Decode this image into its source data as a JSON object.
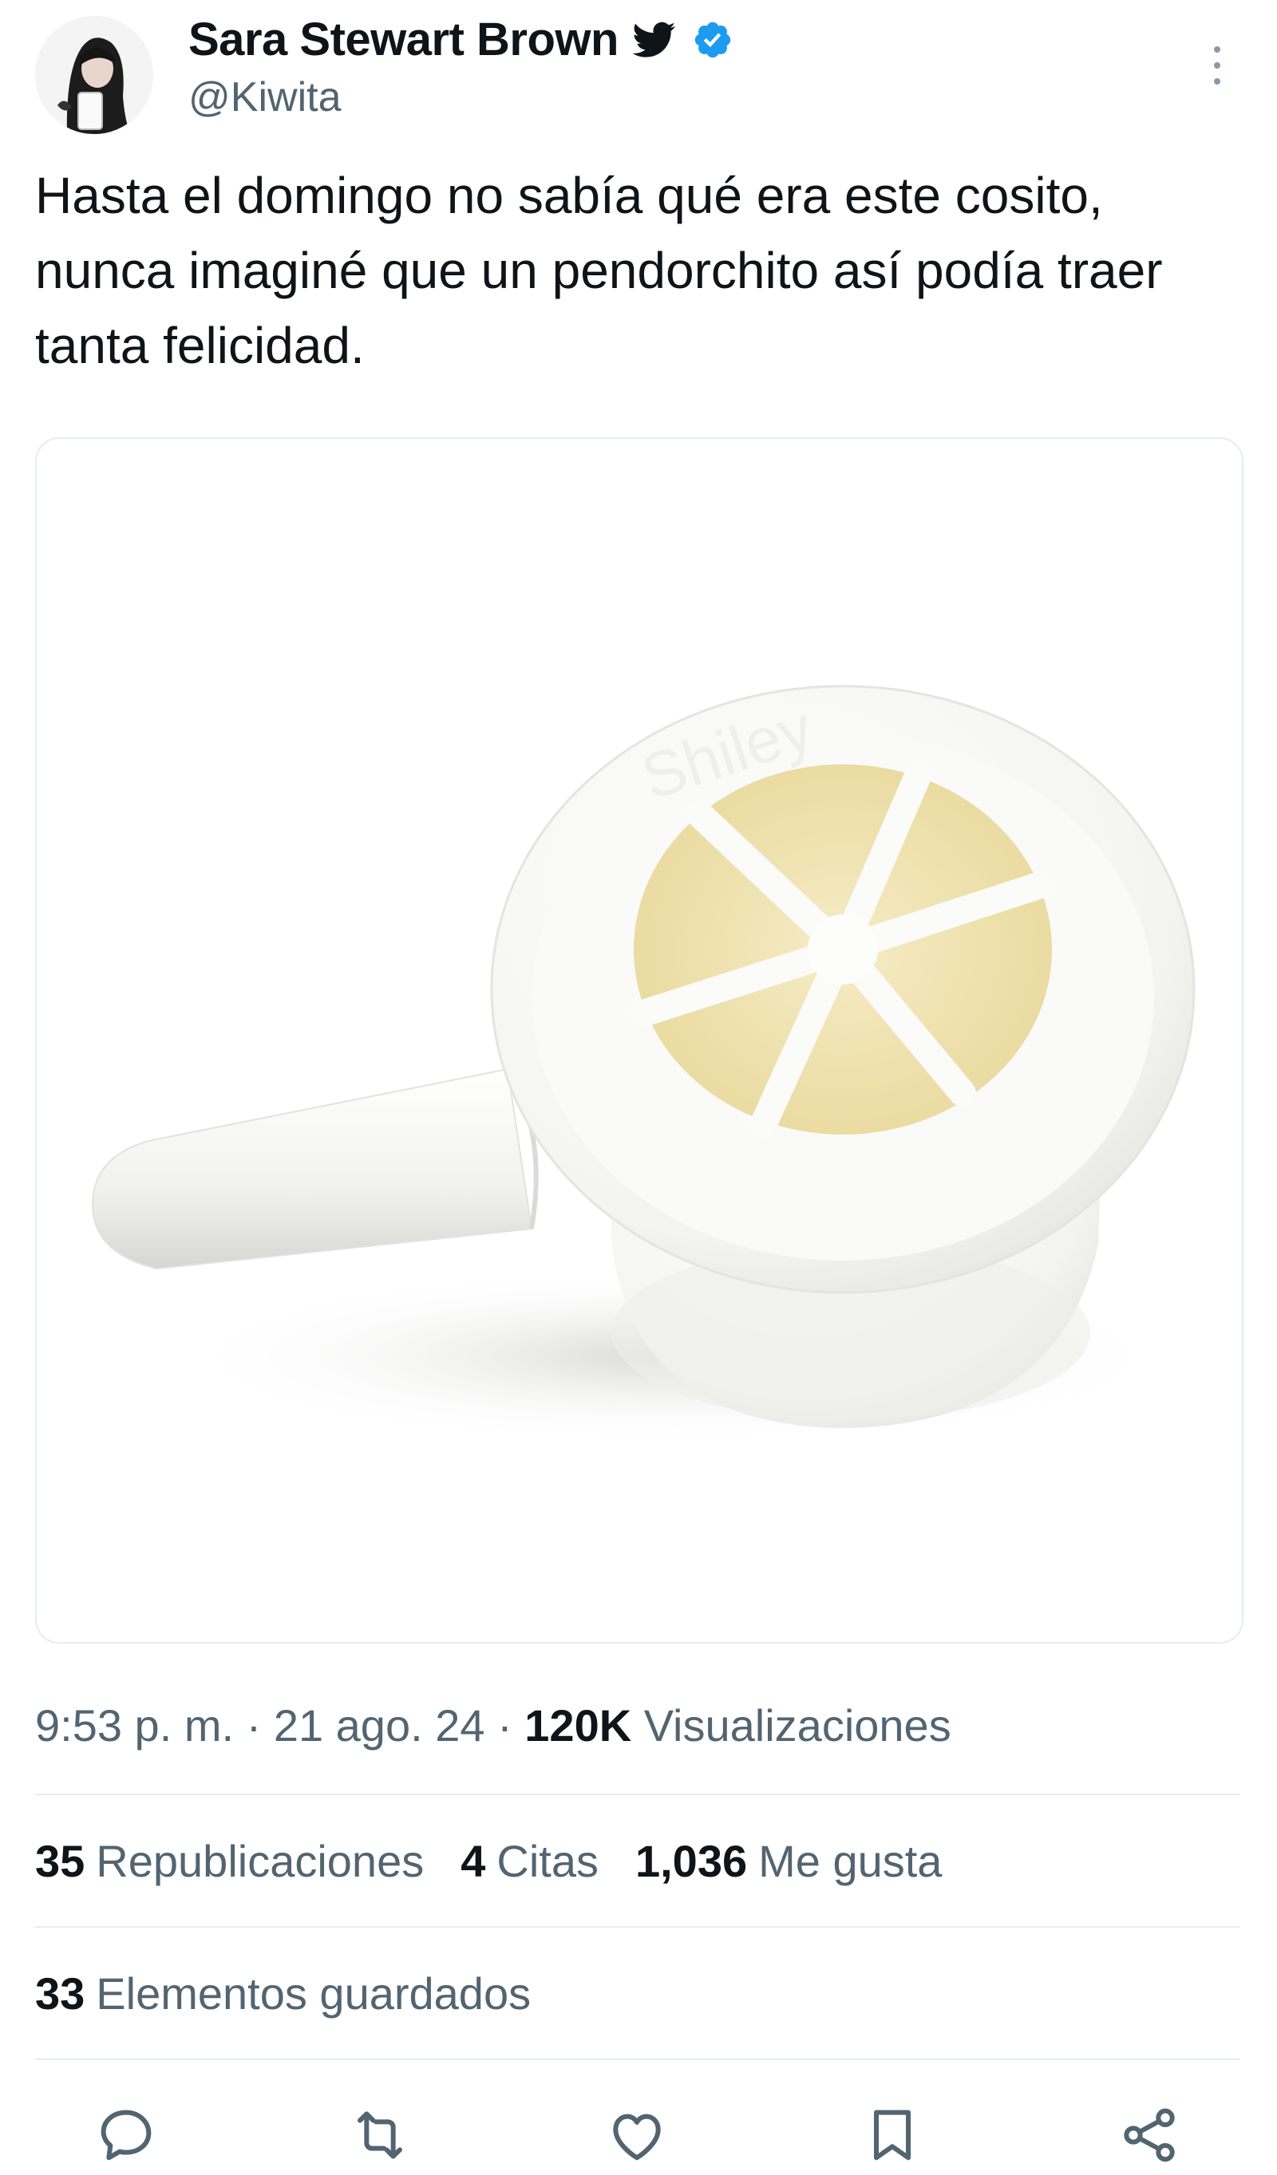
{
  "author": {
    "display_name": "Sara Stewart Brown",
    "handle": "@Kiwita",
    "verified": true
  },
  "tweet": {
    "text": "Hasta el domingo no sabía qué era este cosito, nunca imaginé que un pendorchito así podía traer tanta felicidad."
  },
  "meta": {
    "time": "9:53 p. m.",
    "separator": "·",
    "date": "21 ago. 24",
    "views_count": "120K",
    "views_label": "Visualizaciones"
  },
  "stats": {
    "reposts_count": "35",
    "reposts_label": "Republicaciones",
    "quotes_count": "4",
    "quotes_label": "Citas",
    "likes_count": "1,036",
    "likes_label": "Me gusta"
  },
  "saved": {
    "count": "33",
    "label": "Elementos guardados"
  },
  "icons": {
    "bird": "twitter-bird-icon",
    "verified": "verified-badge-icon",
    "more": "more-options-icon",
    "reply": "reply-icon",
    "retweet": "retweet-icon",
    "like": "heart-icon",
    "bookmark": "bookmark-icon",
    "share": "share-icon"
  },
  "colors": {
    "accent": "#1d9bf0",
    "text_primary": "#0f1419",
    "text_secondary": "#536471",
    "divider": "#e6ecf0"
  }
}
